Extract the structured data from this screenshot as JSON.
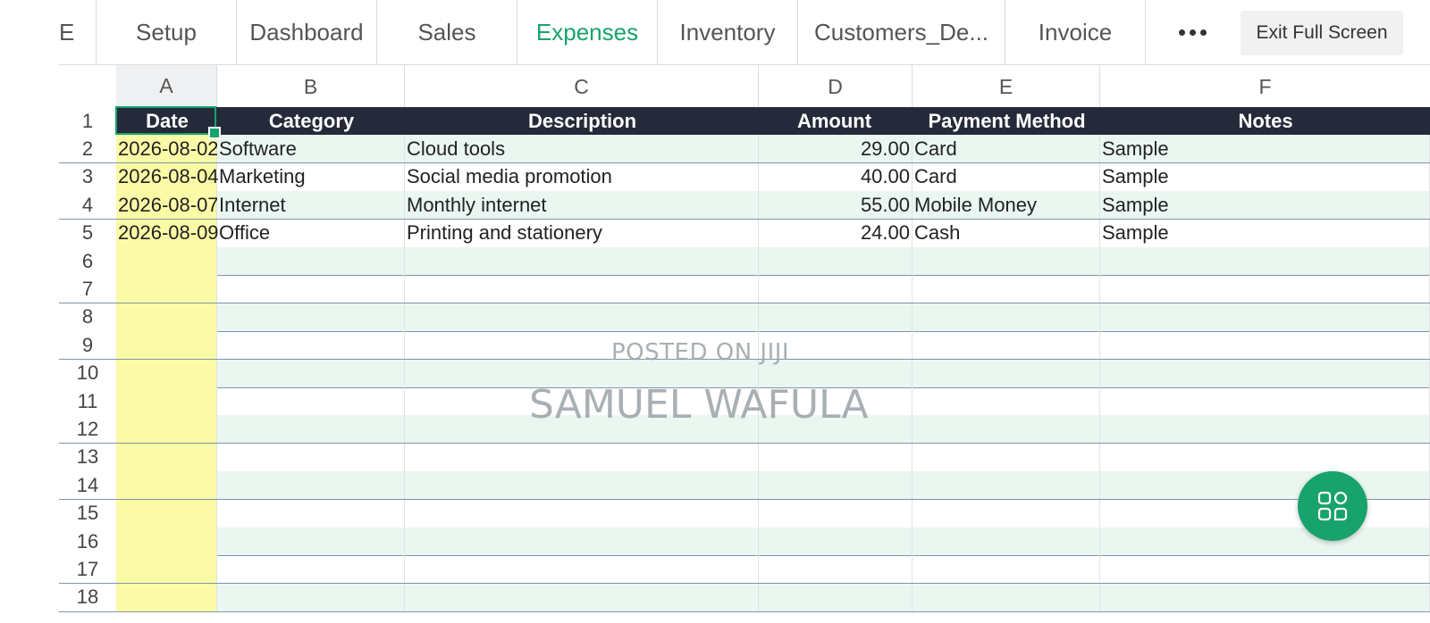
{
  "tabbar": {
    "partial_tab": "E",
    "tabs": [
      {
        "label": "Setup",
        "active": false
      },
      {
        "label": "Dashboard",
        "active": false
      },
      {
        "label": "Sales",
        "active": false
      },
      {
        "label": "Expenses",
        "active": true
      },
      {
        "label": "Inventory",
        "active": false
      },
      {
        "label": "Customers_De...",
        "active": false
      },
      {
        "label": "Invoice",
        "active": false
      }
    ],
    "more_icon": "more-horizontal-icon",
    "exit_label": "Exit Full Screen"
  },
  "grid": {
    "columns": [
      "A",
      "B",
      "C",
      "D",
      "E",
      "F"
    ],
    "selected_column": "A",
    "header": [
      "Date",
      "Category",
      "Description",
      "Amount",
      "Payment Method",
      "Notes"
    ],
    "rows": [
      {
        "num": "1"
      },
      {
        "num": "2",
        "cells": [
          "2026-08-02",
          "Software",
          "Cloud tools",
          "29.00",
          "Card",
          "Sample"
        ]
      },
      {
        "num": "3",
        "cells": [
          "2026-08-04",
          "Marketing",
          "Social media promotion",
          "40.00",
          "Card",
          "Sample"
        ]
      },
      {
        "num": "4",
        "cells": [
          "2026-08-07",
          "Internet",
          "Monthly internet",
          "55.00",
          "Mobile Money",
          "Sample"
        ]
      },
      {
        "num": "5",
        "cells": [
          "2026-08-09",
          "Office",
          "Printing and stationery",
          "24.00",
          "Cash",
          "Sample"
        ]
      },
      {
        "num": "6"
      },
      {
        "num": "7"
      },
      {
        "num": "8"
      },
      {
        "num": "9"
      },
      {
        "num": "10"
      },
      {
        "num": "11"
      },
      {
        "num": "12"
      },
      {
        "num": "13"
      },
      {
        "num": "14"
      },
      {
        "num": "15"
      },
      {
        "num": "16"
      },
      {
        "num": "17"
      },
      {
        "num": "18"
      }
    ],
    "active_cell": "A1"
  },
  "watermark": {
    "line1": "POSTED ON JIJI",
    "line2": "SAMUEL WAFULA"
  },
  "fab": {
    "icon": "apps-grid-icon"
  },
  "colors": {
    "accent": "#17a36b",
    "header_bg": "#252a3a",
    "date_fill": "#fbfaa6",
    "band_fill": "#eaf7f1"
  }
}
